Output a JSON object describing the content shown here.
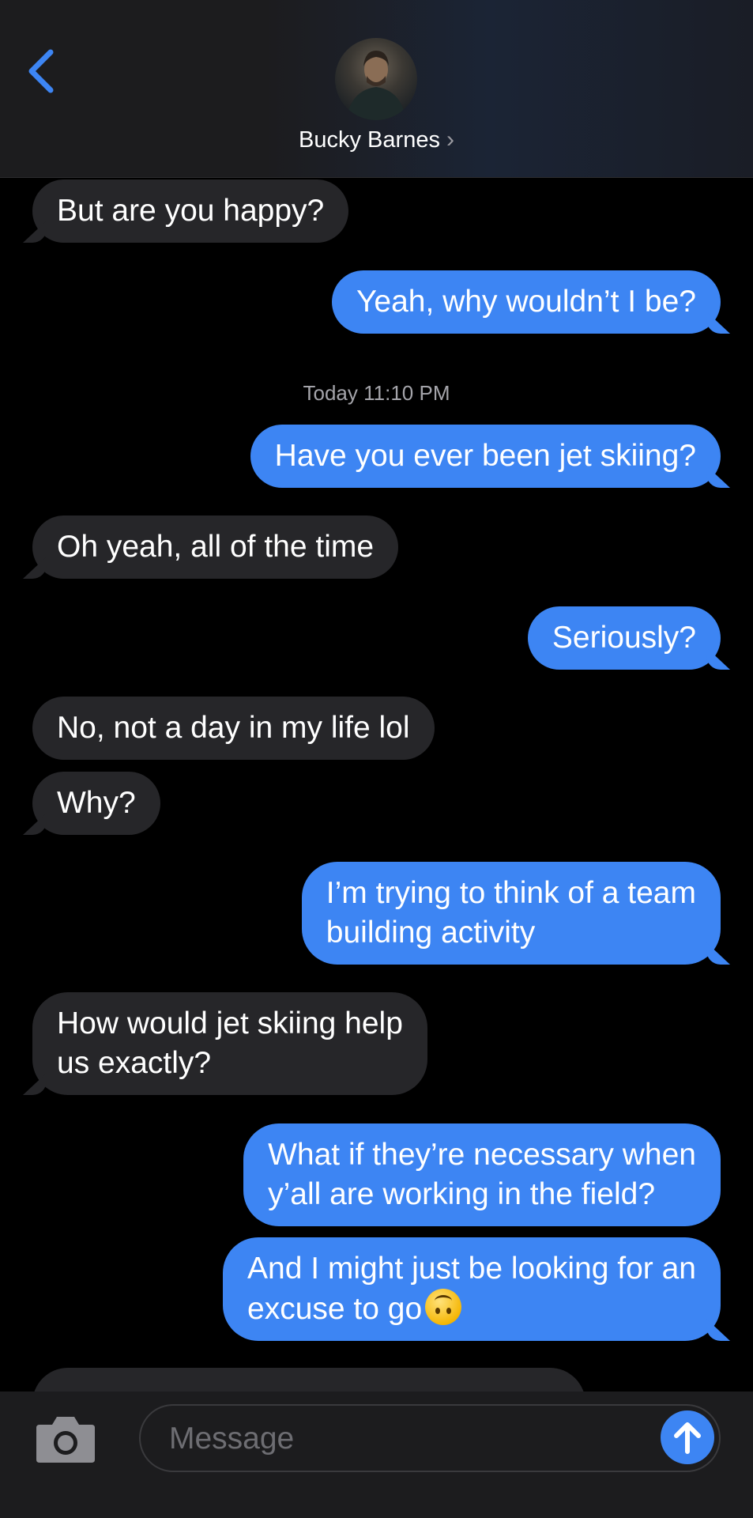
{
  "header": {
    "contact_name": "Bucky Barnes",
    "chevron": "›",
    "accent_color": "#3d85f3"
  },
  "thread": {
    "timestamp": "Today 11:10 PM",
    "messages": [
      {
        "from": "them",
        "text": "But are you happy?"
      },
      {
        "from": "me",
        "text": "Yeah, why wouldn’t I be?"
      },
      {
        "from": "me",
        "text": "Have you ever been jet skiing?"
      },
      {
        "from": "them",
        "text": "Oh yeah, all of the time"
      },
      {
        "from": "me",
        "text": "Seriously?"
      },
      {
        "from": "them",
        "text": "No, not a day in my life lol"
      },
      {
        "from": "them",
        "text": "Why?"
      },
      {
        "from": "me",
        "line1": "I’m trying to think of a team",
        "line2": "building activity"
      },
      {
        "from": "them",
        "line1": "How would jet skiing help",
        "line2": "us exactly?"
      },
      {
        "from": "me",
        "line1": "What if they’re necessary when",
        "line2": "y’all are working in the field?"
      },
      {
        "from": "me",
        "line1": "And I might just be looking for an",
        "line2": "excuse to go",
        "emoji": "upside-down-face"
      }
    ]
  },
  "composer": {
    "placeholder": "Message",
    "camera_icon": "camera-icon",
    "send_icon": "arrow-up-icon"
  }
}
